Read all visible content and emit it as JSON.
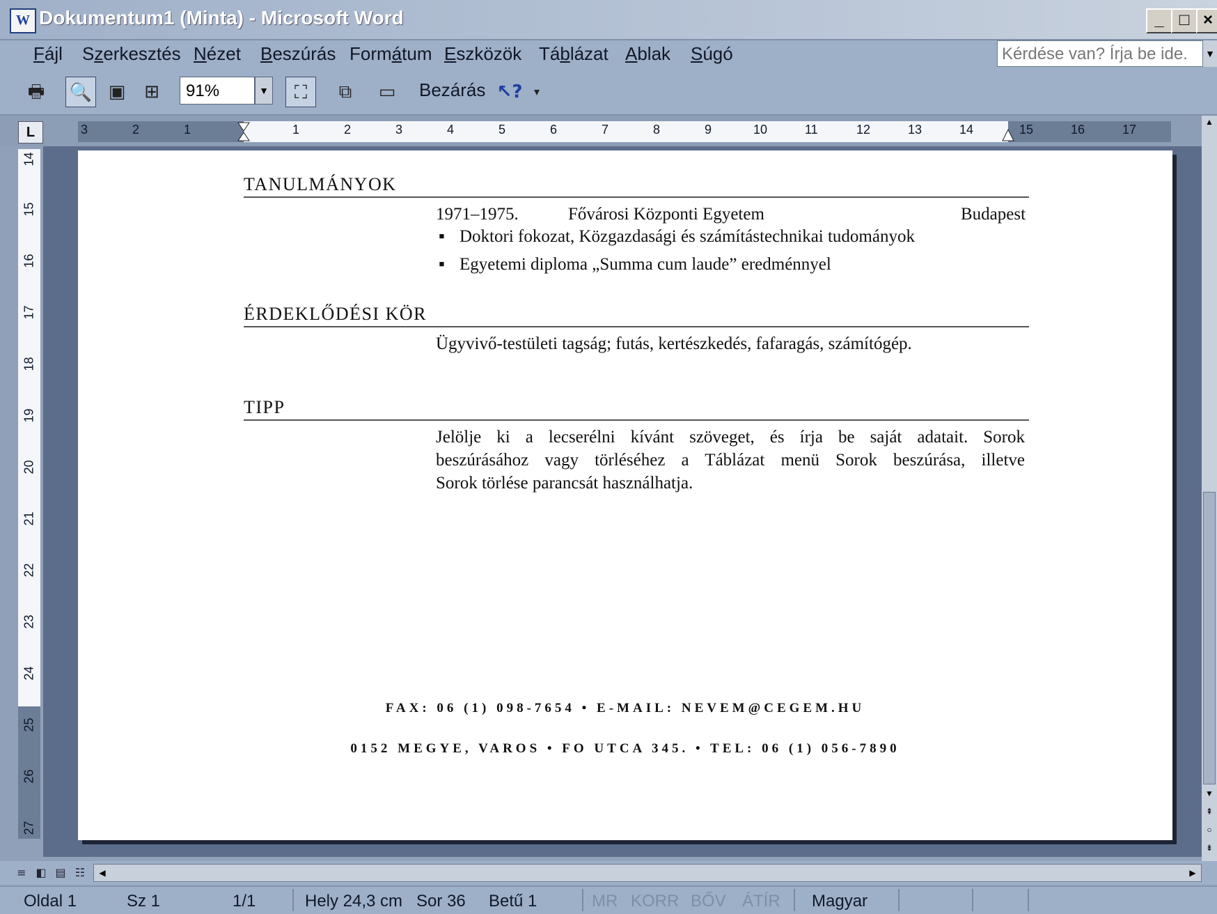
{
  "window": {
    "title": "Dokumentum1 (Minta) - Microsoft Word",
    "app_icon": "W",
    "buttons": {
      "minimize": "_",
      "maximize": "□",
      "close": "×"
    }
  },
  "menu": {
    "items": [
      {
        "label": "Fájl",
        "accel": "F"
      },
      {
        "label": "Szerkesztés",
        "accel": "z"
      },
      {
        "label": "Nézet",
        "accel": "N"
      },
      {
        "label": "Beszúrás",
        "accel": "B"
      },
      {
        "label": "Formátum",
        "accel": "á"
      },
      {
        "label": "Eszközök",
        "accel": "E"
      },
      {
        "label": "Táblázat",
        "accel": "b"
      },
      {
        "label": "Ablak",
        "accel": "A"
      },
      {
        "label": "Súgó",
        "accel": "S"
      }
    ],
    "ask_placeholder": "Kérdése van? Írja be ide."
  },
  "toolbar": {
    "zoom": "91%",
    "close_label": "Bezárás"
  },
  "ruler": {
    "h_numbers": [
      "3",
      "2",
      "1",
      "1",
      "2",
      "3",
      "4",
      "5",
      "6",
      "7",
      "8",
      "9",
      "10",
      "11",
      "12",
      "13",
      "14",
      "15",
      "16",
      "17"
    ],
    "v_numbers": [
      "14",
      "15",
      "16",
      "17",
      "18",
      "19",
      "20",
      "21",
      "22",
      "23",
      "24",
      "25",
      "26",
      "27"
    ]
  },
  "document": {
    "sections": [
      {
        "heading": "TANULMÁNYOK",
        "years": "1971–1975.",
        "institution": "Fővárosi Központi Egyetem",
        "city": "Budapest",
        "bullets": [
          "Doktori fokozat, Közgazdasági és számítástechnikai tudományok",
          "Egyetemi diploma „Summa cum laude” eredménnyel"
        ]
      },
      {
        "heading": "ÉRDEKLŐDÉSI KÖR",
        "text": "Ügyvivő-testületi tagság; futás, kertészkedés, fafaragás, számítógép."
      },
      {
        "heading": "TIPP",
        "lines": [
          "Jelölje ki a lecserélni kívánt szöveget, és írja be saját adatait. Sorok",
          "beszúrásához vagy törléséhez a Táblázat menü Sorok beszúrása, illetve",
          "Sorok törlése parancsát használhatja."
        ]
      }
    ],
    "footer": {
      "line1": "FAX: 06 (1) 098-7654 • E-MAIL: NEVEM@CEGEM.HU",
      "line2": "0152 MEGYE, VAROS • FO UTCA 345. • TEL: 06 (1) 056-7890"
    }
  },
  "status": {
    "page": "Oldal 1",
    "section": "Sz 1",
    "pages": "1/1",
    "position": "Hely 24,3 cm",
    "line": "Sor 36",
    "column": "Betű 1",
    "rec": "MR",
    "track": "KORR",
    "ext": "BŐV",
    "ovr": "ÁTÍR",
    "language": "Magyar"
  }
}
